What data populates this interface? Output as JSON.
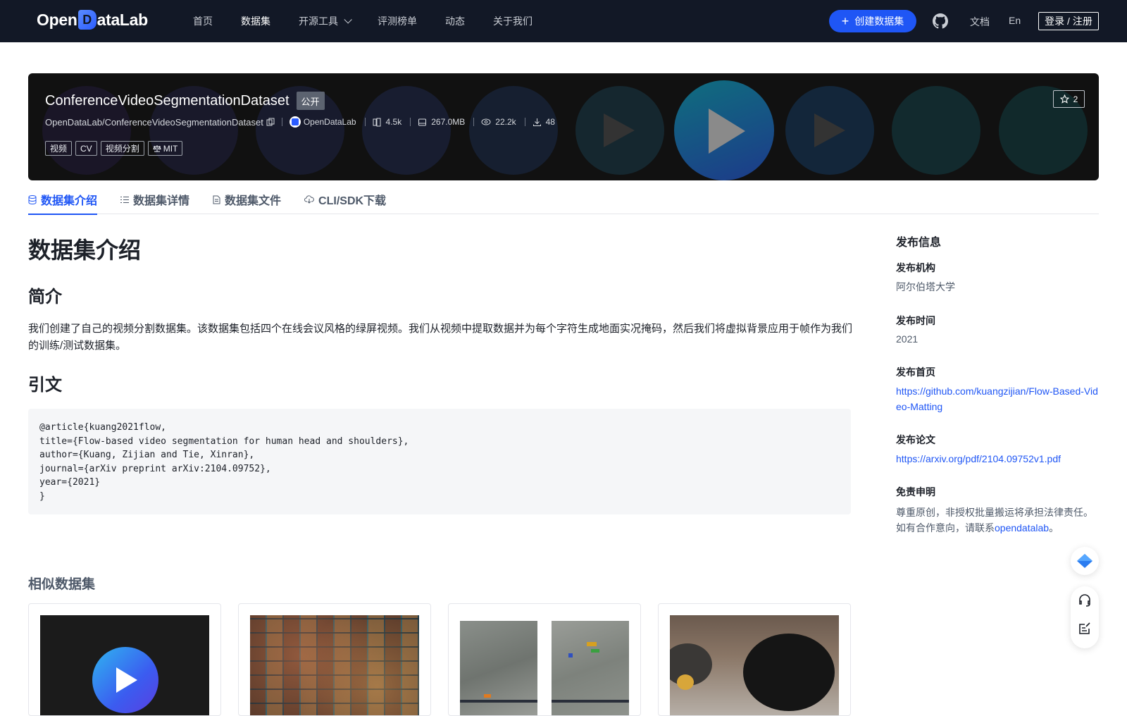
{
  "topbar": {
    "logo_left": "Open",
    "logo_d": "D",
    "logo_right": "ataLab",
    "nav": [
      "首页",
      "数据集",
      "开源工具",
      "评测榜单",
      "动态",
      "关于我们"
    ],
    "active_nav": "数据集",
    "create_button": "创建数据集",
    "docs": "文档",
    "lang": "En",
    "login": "登录 / 注册"
  },
  "banner": {
    "title": "ConferenceVideoSegmentationDataset",
    "visibility": "公开",
    "repo_path": "OpenDataLab/ConferenceVideoSegmentationDataset",
    "org": "OpenDataLab",
    "file_count": "4.5k",
    "size": "267.0MB",
    "views": "22.2k",
    "downloads": "48",
    "tags": [
      "视频",
      "CV",
      "视频分割"
    ],
    "license": "MIT",
    "stars": "2"
  },
  "tabs": [
    "数据集介绍",
    "数据集详情",
    "数据集文件",
    "CLI/SDK下载"
  ],
  "main": {
    "heading": "数据集介绍",
    "intro_heading": "简介",
    "intro_text": "我们创建了自己的视频分割数据集。该数据集包括四个在线会议风格的绿屏视频。我们从视频中提取数据并为每个字符生成地面实况掩码，然后我们将虚拟背景应用于帧作为我们的训练/测试数据集。",
    "citation_heading": "引文",
    "citation": "@article{kuang2021flow,\ntitle={Flow-based video segmentation for human head and shoulders},\nauthor={Kuang, Zijian and Tie, Xinran},\njournal={arXiv preprint arXiv:2104.09752},\nyear={2021}\n}",
    "similar_heading": "相似数据集"
  },
  "sidebar": {
    "title": "发布信息",
    "org_label": "发布机构",
    "org_value": "阿尔伯塔大学",
    "time_label": "发布时间",
    "time_value": "2021",
    "home_label": "发布首页",
    "home_value": "https://github.com/kuangzijian/Flow-Based-Video-Matting",
    "paper_label": "发布论文",
    "paper_value": "https://arxiv.org/pdf/2104.09752v1.pdf",
    "disclaimer_label": "免责申明",
    "disclaimer_text": "尊重原创，非授权批量搬运将承担法律责任。如有合作意向，请联系",
    "disclaimer_link": "opendatalab",
    "disclaimer_end": "。"
  },
  "icons": {
    "github": "github-icon",
    "star": "star-icon",
    "copy": "copy-icon",
    "files": "files-icon",
    "disk": "disk-icon",
    "eye": "eye-icon",
    "download": "download-icon",
    "scale": "scale-icon"
  },
  "colors": {
    "nav_bg": "#121826",
    "accent": "#1f56f5",
    "banner_bg": "#111111"
  }
}
